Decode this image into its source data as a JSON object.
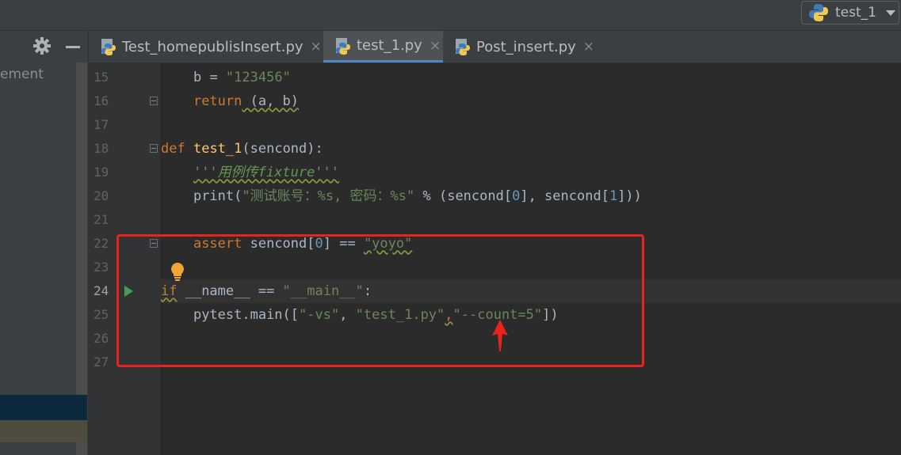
{
  "run_config": {
    "label": "test_1",
    "icon": "python-icon",
    "dropdown_icon": "caret-down-icon"
  },
  "project_panel": {
    "tree_text": "ement",
    "settings_icon": "gear-icon",
    "hide_icon": "minus-icon"
  },
  "tabs": [
    {
      "label": "Test_homepublisInsert.py",
      "close": "×",
      "active": false
    },
    {
      "label": "test_1.py",
      "close": "×",
      "active": true
    },
    {
      "label": "Post_insert.py",
      "close": "×",
      "active": false
    }
  ],
  "editor": {
    "line_numbers": [
      "15",
      "16",
      "17",
      "18",
      "19",
      "20",
      "21",
      "22",
      "23",
      "24",
      "25",
      "26",
      "27"
    ],
    "lines": {
      "l15": {
        "indent": "    ",
        "var": "b",
        "op": " = ",
        "str": "\"123456\""
      },
      "l16": {
        "indent": "    ",
        "kw": "return",
        "rest": " (a, b)"
      },
      "l18": {
        "kw": "def",
        "space": " ",
        "name": "test_1",
        "rest": "(sencond):"
      },
      "l19": {
        "indent": "    ",
        "doc": "'''用例传fixture'''"
      },
      "l20": {
        "indent": "    ",
        "pre": "print(",
        "str": "\"测试账号：%s, 密码：%s\"",
        "mid1": " % (sencond[",
        "n0": "0",
        "mid2": "], sencond[",
        "n1": "1",
        "end": "]))"
      },
      "l22": {
        "indent": "    ",
        "kw": "assert",
        "mid": " sencond[",
        "n0": "0",
        "mid2": "] == ",
        "str": "\"yoyo\""
      },
      "l24": {
        "kw": "if",
        "mid": " __name__ == ",
        "str": "\"__main__\"",
        "end": ":"
      },
      "l25": {
        "indent": "    ",
        "pre": "pytest.main([",
        "s1": "\"-vs\"",
        "c1": ", ",
        "s2": "\"test_1.py\"",
        "c2": ",",
        "s3": "\"--count=5\"",
        "end": "])"
      }
    },
    "current_line": "24"
  },
  "colors": {
    "accent": "#4a88c7",
    "annotation": "#e8231b",
    "keyword": "#cc7832",
    "string": "#6a8759",
    "run": "#499c54"
  }
}
